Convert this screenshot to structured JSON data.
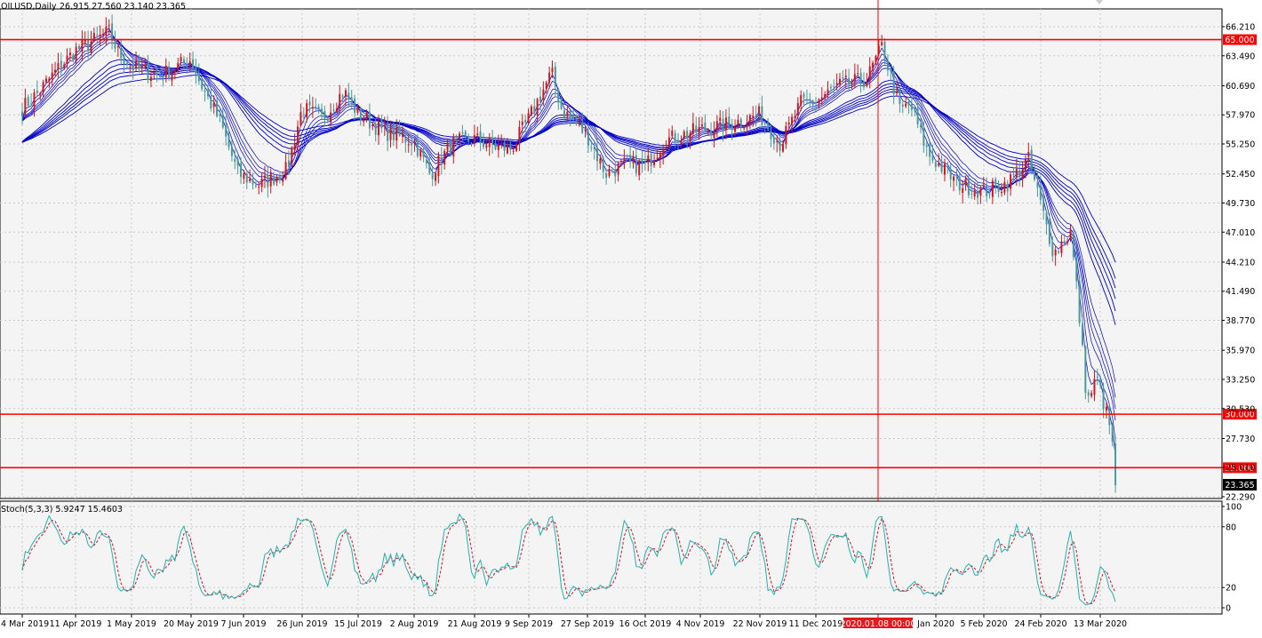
{
  "window": {
    "symbol_label": "OILUSD,Daily",
    "ohlc_text": "26.915 27.560 23.140 23.365"
  },
  "colors": {
    "background": "#ffffff",
    "plot_bg": "#f4f4f4",
    "grid": "#c8c8c8",
    "bull": "#d1161d",
    "bear": "#4b9a9a",
    "ma": "#0000c8",
    "hline": "#ff0000",
    "stoch_main": "#24b1b1",
    "stoch_signal": "#d1161d",
    "crosshair": "#ff0000"
  },
  "chart_data": [
    {
      "type": "candlestick",
      "y_ticks": [
        "66.210",
        "63.490",
        "60.690",
        "57.970",
        "55.250",
        "52.450",
        "49.730",
        "47.010",
        "44.210",
        "41.490",
        "38.770",
        "35.970",
        "33.250",
        "30.530",
        "27.730",
        "25.010",
        "22.290"
      ],
      "ylim": [
        22.29,
        66.21
      ],
      "x_ticks": [
        "4 Mar 2019",
        "11 Apr 2019",
        "1 May 2019",
        "20 May 2019",
        "7 Jun 2019",
        "26 Jun 2019",
        "15 Jul 2019",
        "2 Aug 2019",
        "21 Aug 2019",
        "9 Sep 2019",
        "27 Sep 2019",
        "16 Oct 2019",
        "4 Nov 2019",
        "22 Nov 2019",
        "11 Dec 2019",
        "Jan 2020",
        "5 Feb 2020",
        "24 Feb 2020",
        "13 Mar 2020"
      ],
      "crosshair_label": "2020.01.08 00:00",
      "current_price": "23.365",
      "horizontal_lines": [
        {
          "price": 65.0,
          "label": "65.000"
        },
        {
          "price": 30.0,
          "label": "30.000"
        },
        {
          "price": 25.0,
          "label": "25.000"
        }
      ],
      "close_anchors": [
        {
          "x": "4 Mar 2019",
          "y": 58.6
        },
        {
          "x": "15 Mar 2019",
          "y": 60.0
        },
        {
          "x": "29 Mar 2019",
          "y": 62.2
        },
        {
          "x": "11 Apr 2019",
          "y": 64.0
        },
        {
          "x": "23 Apr 2019",
          "y": 65.7
        },
        {
          "x": "26 Apr 2019",
          "y": 63.9
        },
        {
          "x": "1 May 2019",
          "y": 62.5
        },
        {
          "x": "10 May 2019",
          "y": 61.6
        },
        {
          "x": "20 May 2019",
          "y": 63.2
        },
        {
          "x": "23 May 2019",
          "y": 61.0
        },
        {
          "x": "30 May 2019",
          "y": 57.3
        },
        {
          "x": "5 Jun 2019",
          "y": 52.5
        },
        {
          "x": "12 Jun 2019",
          "y": 51.4
        },
        {
          "x": "21 Jun 2019",
          "y": 52.8
        },
        {
          "x": "26 Jun 2019",
          "y": 58.6
        },
        {
          "x": "3 Jul 2019",
          "y": 57.6
        },
        {
          "x": "10 Jul 2019",
          "y": 60.2
        },
        {
          "x": "15 Jul 2019",
          "y": 58.1
        },
        {
          "x": "23 Jul 2019",
          "y": 56.4
        },
        {
          "x": "2 Aug 2019",
          "y": 55.5
        },
        {
          "x": "7 Aug 2019",
          "y": 52.4
        },
        {
          "x": "14 Aug 2019",
          "y": 55.3
        },
        {
          "x": "21 Aug 2019",
          "y": 55.7
        },
        {
          "x": "28 Aug 2019",
          "y": 55.0
        },
        {
          "x": "3 Sep 2019",
          "y": 54.8
        },
        {
          "x": "9 Sep 2019",
          "y": 57.6
        },
        {
          "x": "16 Sep 2019",
          "y": 61.9
        },
        {
          "x": "19 Sep 2019",
          "y": 58.6
        },
        {
          "x": "27 Sep 2019",
          "y": 56.0
        },
        {
          "x": "3 Oct 2019",
          "y": 52.5
        },
        {
          "x": "10 Oct 2019",
          "y": 53.4
        },
        {
          "x": "16 Oct 2019",
          "y": 53.2
        },
        {
          "x": "23 Oct 2019",
          "y": 55.6
        },
        {
          "x": "4 Nov 2019",
          "y": 56.6
        },
        {
          "x": "13 Nov 2019",
          "y": 57.1
        },
        {
          "x": "22 Nov 2019",
          "y": 58.0
        },
        {
          "x": "29 Nov 2019",
          "y": 55.2
        },
        {
          "x": "6 Dec 2019",
          "y": 59.1
        },
        {
          "x": "11 Dec 2019",
          "y": 59.2
        },
        {
          "x": "20 Dec 2019",
          "y": 60.7
        },
        {
          "x": "31 Dec 2019",
          "y": 61.3
        },
        {
          "x": "6 Jan 2020",
          "y": 64.4
        },
        {
          "x": "8 Jan 2020",
          "y": 62.7
        },
        {
          "x": "13 Jan 2020",
          "y": 58.4
        },
        {
          "x": "17 Jan 2020",
          "y": 58.9
        },
        {
          "x": "24 Jan 2020",
          "y": 54.3
        },
        {
          "x": "31 Jan 2020",
          "y": 51.6
        },
        {
          "x": "5 Feb 2020",
          "y": 50.8
        },
        {
          "x": "13 Feb 2020",
          "y": 51.6
        },
        {
          "x": "20 Feb 2020",
          "y": 53.8
        },
        {
          "x": "28 Feb 2020",
          "y": 45.0
        },
        {
          "x": "4 Mar 2020",
          "y": 47.0
        },
        {
          "x": "6 Mar 2020",
          "y": 41.4
        },
        {
          "x": "9 Mar 2020",
          "y": 31.1
        },
        {
          "x": "12 Mar 2020",
          "y": 33.4
        },
        {
          "x": "16 Mar 2020",
          "y": 28.7
        },
        {
          "x": "18 Mar 2020",
          "y": 23.365
        }
      ]
    },
    {
      "type": "line",
      "label": "Stoch(5,3,3) 5.9247 15.4603",
      "y_ticks": [
        "100",
        "80",
        "20",
        "0"
      ],
      "ylim": [
        0,
        100
      ],
      "main_last": 5.9247,
      "signal_last": 15.4603
    }
  ]
}
